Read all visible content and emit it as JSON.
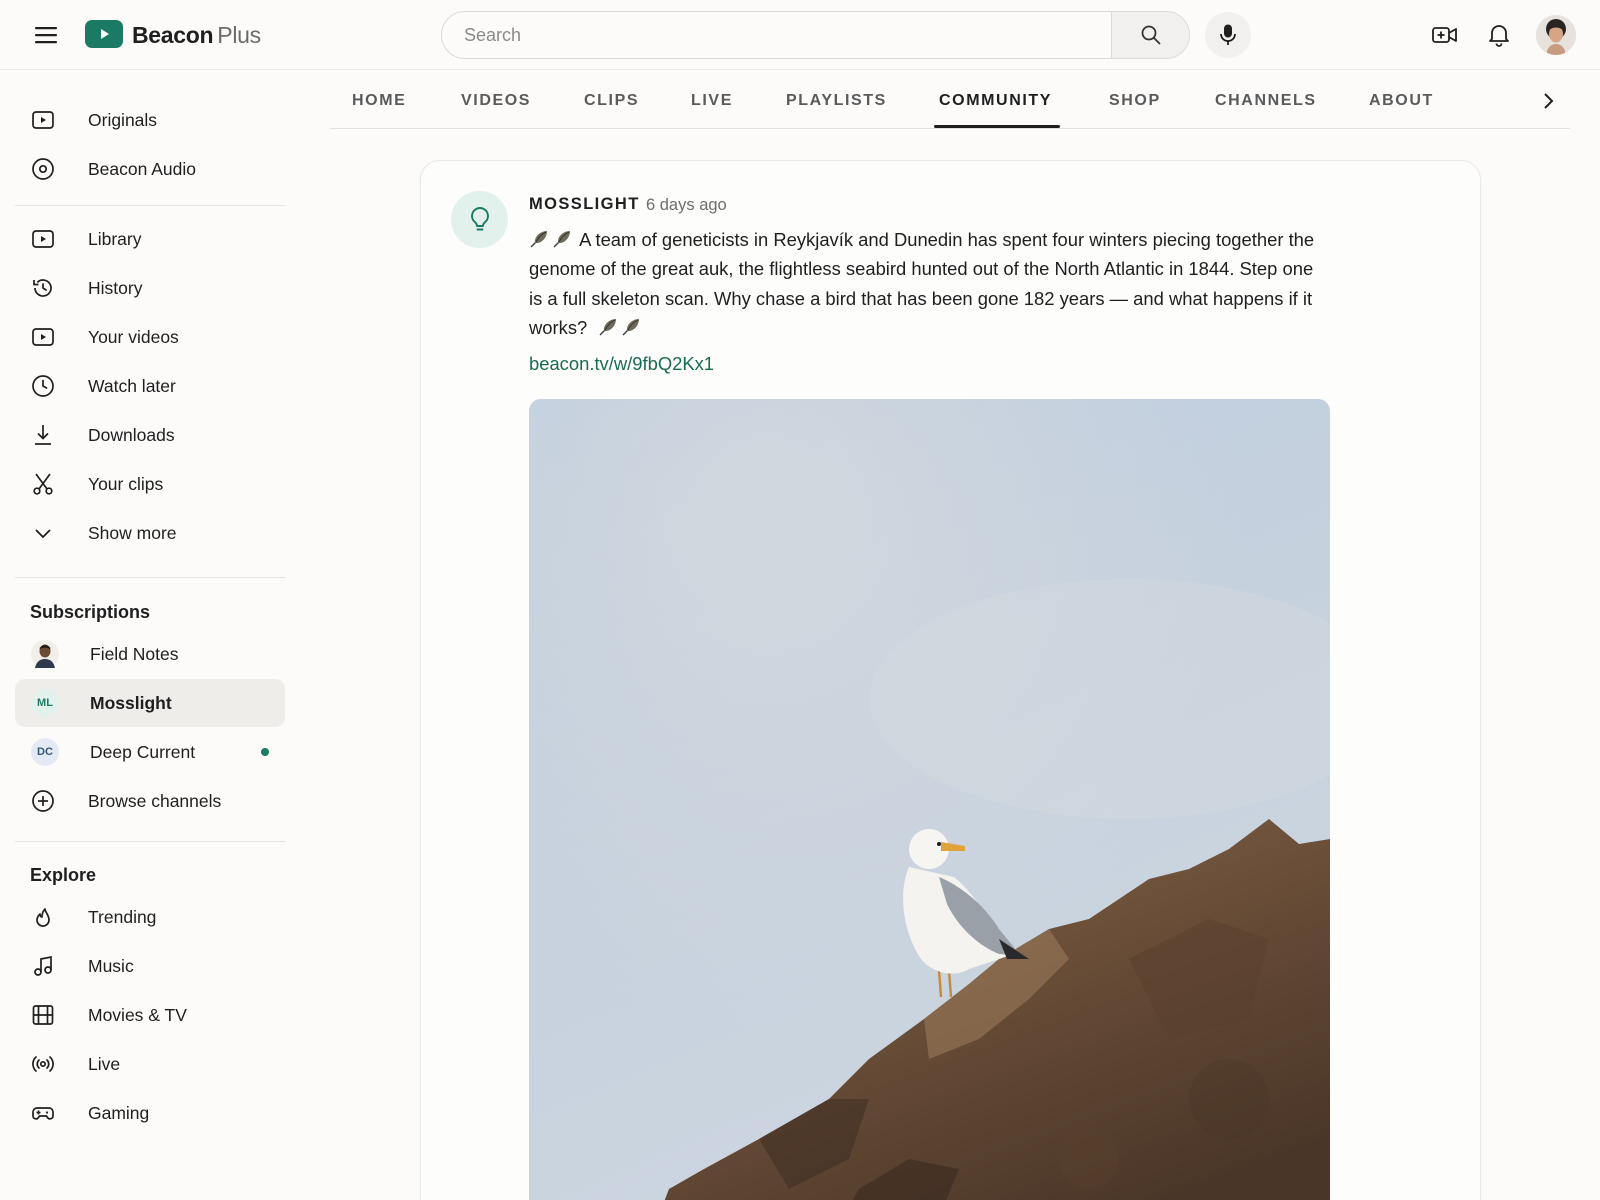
{
  "header": {
    "brand_bold": "Beacon",
    "brand_light": "Plus",
    "search_placeholder": "Search"
  },
  "sidebar": {
    "primary": [
      {
        "label": "Originals",
        "icon": "play-square-icon"
      },
      {
        "label": "Beacon Audio",
        "icon": "disc-icon"
      }
    ],
    "you": [
      {
        "label": "Library",
        "icon": "play-square-icon"
      },
      {
        "label": "History",
        "icon": "history-icon"
      },
      {
        "label": "Your videos",
        "icon": "play-square-icon"
      },
      {
        "label": "Watch later",
        "icon": "clock-icon"
      },
      {
        "label": "Downloads",
        "icon": "download-icon"
      },
      {
        "label": "Your clips",
        "icon": "scissors-icon"
      },
      {
        "label": "Show more",
        "icon": "chevron-down-icon"
      }
    ],
    "subscriptions_title": "Subscriptions",
    "subscriptions": [
      {
        "label": "Field Notes"
      },
      {
        "label": "Mosslight",
        "badge": "ML",
        "active": true
      },
      {
        "label": "Deep Current",
        "badge": "DC",
        "new": true
      },
      {
        "label": "Browse channels"
      }
    ],
    "explore_title": "Explore",
    "explore": [
      {
        "label": "Trending",
        "icon": "flame-icon"
      },
      {
        "label": "Music",
        "icon": "music-note-icon"
      },
      {
        "label": "Movies & TV",
        "icon": "film-icon"
      },
      {
        "label": "Live",
        "icon": "broadcast-icon"
      },
      {
        "label": "Gaming",
        "icon": "gamepad-icon"
      }
    ]
  },
  "tabs": [
    "HOME",
    "VIDEOS",
    "CLIPS",
    "LIVE",
    "PLAYLISTS",
    "COMMUNITY",
    "SHOP",
    "CHANNELS",
    "ABOUT"
  ],
  "active_tab": "COMMUNITY",
  "post": {
    "author": "MOSSLIGHT",
    "time": "6 days ago",
    "text": "A team of geneticists in Reykjavík and Dunedin has spent four winters piecing together the genome of the great auk, the flightless seabird hunted out of the North Atlantic in 1844. Step one is a full skeleton scan. Why chase a bird that has been gone 182 years — and what happens if it works?",
    "link": "beacon.tv/w/9fbQ2Kx1"
  },
  "colors": {
    "brand": "#1b7a63",
    "link": "#1a6b54",
    "active_row": "#efedea"
  }
}
